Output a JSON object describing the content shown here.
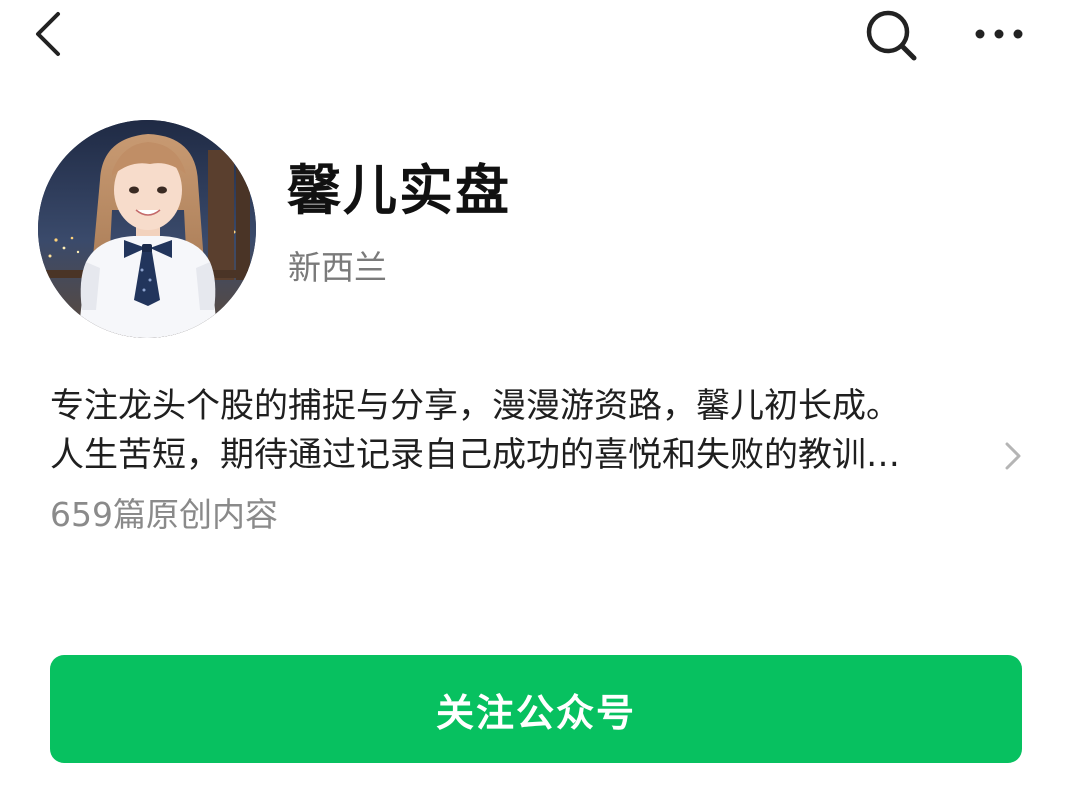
{
  "header": {
    "back_icon": "chevron-left-icon",
    "search_icon": "search-icon",
    "more_icon": "more-dots-icon"
  },
  "profile": {
    "name": "馨儿实盘",
    "region": "新西兰",
    "avatar": "profile-photo"
  },
  "bio": {
    "line1": "专注龙头个股的捕捉与分享，漫漫游资路，馨儿初长成。",
    "line2": "人生苦短，期待通过记录自己成功的喜悦和失败的教训…",
    "chevron_icon": "chevron-right-icon"
  },
  "stats": {
    "article_count": "659篇原创内容"
  },
  "actions": {
    "follow_label": "关注公众号"
  },
  "colors": {
    "accent": "#07c160",
    "text_primary": "#111111",
    "text_secondary": "#7a7a7a"
  }
}
